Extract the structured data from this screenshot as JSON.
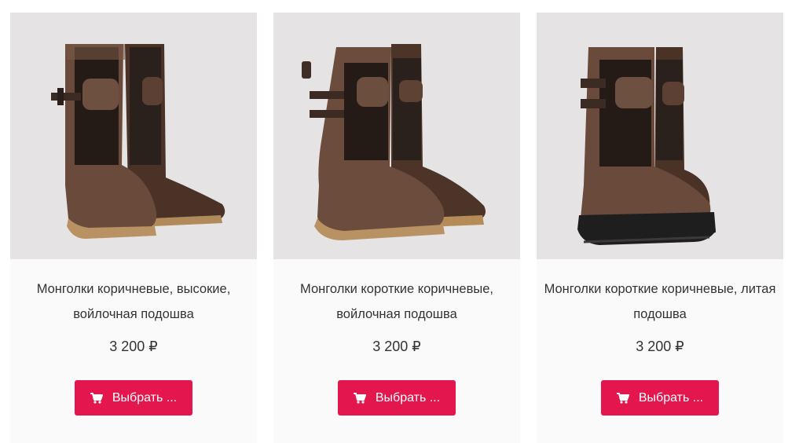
{
  "products": [
    {
      "title": "Монголки коричневые, высокие, войлочная подошва",
      "price": "3 200 ₽",
      "button_label": "Выбрать ...",
      "image": "boots-brown-high-felt-sole"
    },
    {
      "title": "Монголки короткие коричневые, войлочная подошва",
      "price": "3 200 ₽",
      "button_label": "Выбрать ...",
      "image": "boots-brown-short-felt-sole"
    },
    {
      "title": "Монголки короткие коричневые, литая подошва",
      "price": "3 200 ₽",
      "button_label": "Выбрать ...",
      "image": "boots-brown-short-cast-sole"
    }
  ],
  "colors": {
    "button": "#e3174d",
    "photo_bg": "#e5e3e4",
    "card_bg": "#fafafa",
    "text": "#333333"
  },
  "icons": {
    "button_icon": "cart-icon"
  }
}
